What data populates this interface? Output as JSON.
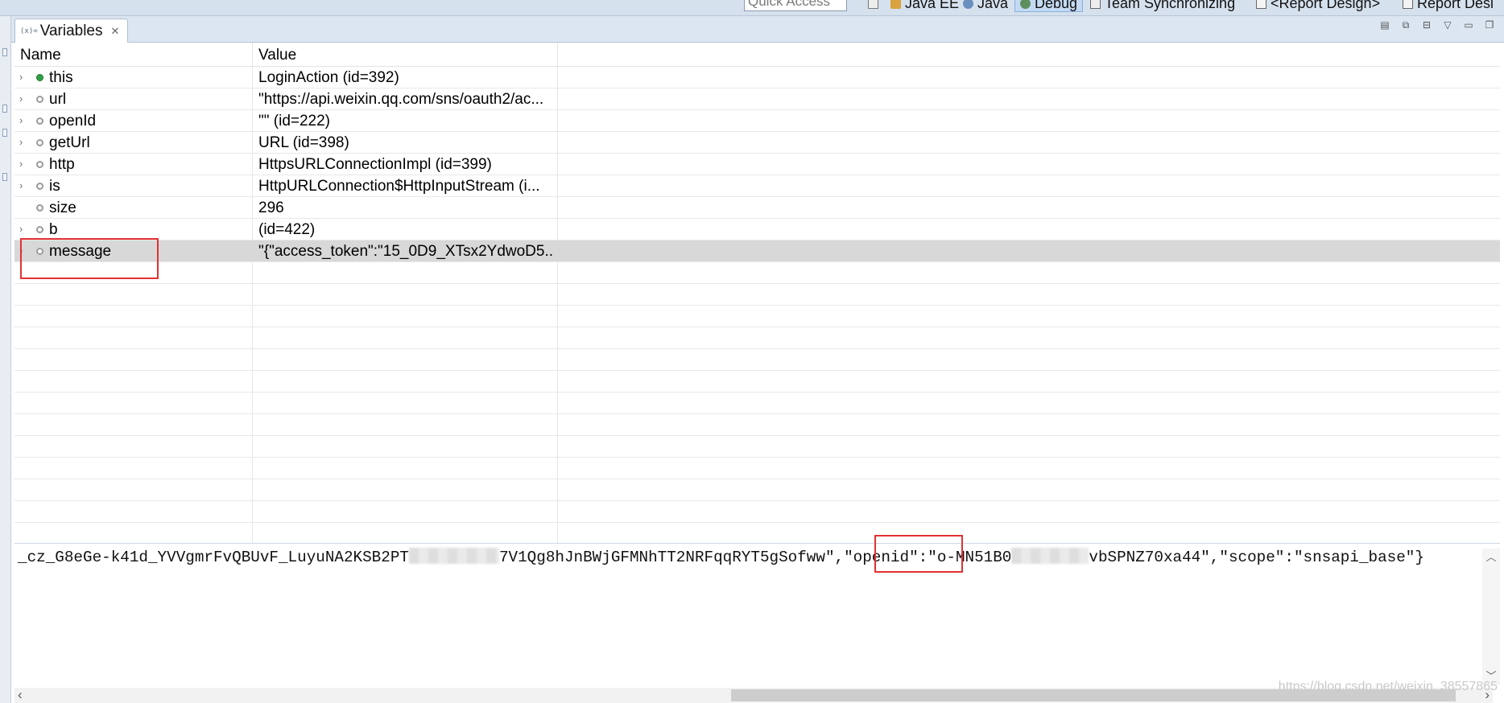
{
  "toolbar": {
    "quick_access_placeholder": "Quick Access",
    "perspectives": [
      {
        "label": "Java EE",
        "icon": "java-ee-icon",
        "active": false
      },
      {
        "label": "Java",
        "icon": "java-icon",
        "active": false
      },
      {
        "label": "Debug",
        "icon": "debug-icon",
        "active": true
      },
      {
        "label": "Team Synchronizing",
        "icon": "team-sync-icon",
        "active": false
      },
      {
        "label": "<Report Design>",
        "icon": "report-design-icon",
        "active": false
      },
      {
        "label": "Report Desi",
        "icon": "report-design-icon",
        "active": false
      }
    ]
  },
  "view": {
    "tab_icon": "(x)=",
    "tab_label": "Variables",
    "tab_close": "✕"
  },
  "table": {
    "columns": [
      "Name",
      "Value"
    ],
    "rows": [
      {
        "name": "this",
        "value": "LoginAction  (id=392)",
        "expandable": true,
        "kind": "public"
      },
      {
        "name": "url",
        "value": "\"https://api.weixin.qq.com/sns/oauth2/ac...",
        "expandable": true,
        "kind": "local"
      },
      {
        "name": "openId",
        "value": "\"\" (id=222)",
        "expandable": true,
        "kind": "local"
      },
      {
        "name": "getUrl",
        "value": "URL  (id=398)",
        "expandable": true,
        "kind": "local"
      },
      {
        "name": "http",
        "value": "HttpsURLConnectionImpl  (id=399)",
        "expandable": true,
        "kind": "local"
      },
      {
        "name": "is",
        "value": "HttpURLConnection$HttpInputStream  (i...",
        "expandable": true,
        "kind": "local"
      },
      {
        "name": "size",
        "value": "296",
        "expandable": false,
        "kind": "local"
      },
      {
        "name": "b",
        "value": "(id=422)",
        "expandable": true,
        "kind": "local"
      },
      {
        "name": "message",
        "value": "\"{\"access_token\":\"15_0D9_XTsx2YdwoD5...",
        "expandable": true,
        "kind": "local",
        "selected": true
      }
    ]
  },
  "detail": {
    "part1": "_cz_G8eGe-k41d_YVVgmrFvQBUvF_LuyuNA2KSB2PT",
    "part2": "7V1Qg8hJnBWjGFMNhTT2NRFqqRYT5gSofww\",",
    "part3": "\"openid\"",
    "part4": ":\"o-MN51B0",
    "part5": "vbSPNZ70xa44\",\"scope\":\"snsapi_base\"}"
  },
  "watermark": "https://blog.csdn.net/weixin_38557865"
}
